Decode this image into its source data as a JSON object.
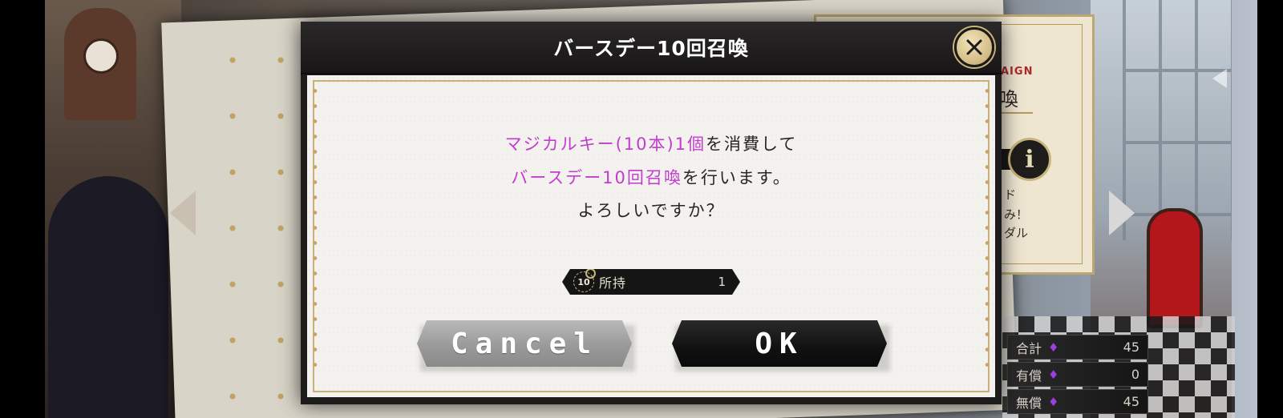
{
  "dialog": {
    "title": "バースデー10回召喚",
    "message": {
      "line1_highlight": "マジカルキー(10本)1個",
      "line1_rest": "を消費して",
      "line2_highlight": "バースデー10回召喚",
      "line2_rest": "を行います。",
      "line3": "よろしいですか？"
    },
    "owned": {
      "icon_label": "10",
      "label": "所持",
      "count": "1"
    },
    "cancel_label": "Cancel",
    "ok_label": "OK",
    "highlight_color": "#c23ccf"
  },
  "background_card": {
    "campaign_text": "AIGN",
    "title_fragment": "喚",
    "info_icon": "i",
    "lines": [
      "ド",
      "み！",
      "ダル"
    ]
  },
  "currency": [
    {
      "label": "合計",
      "icon": "gem-icon",
      "value": "45"
    },
    {
      "label": "有償",
      "icon": "gem-icon",
      "value": "0"
    },
    {
      "label": "無償",
      "icon": "gem-icon",
      "value": "45"
    }
  ]
}
